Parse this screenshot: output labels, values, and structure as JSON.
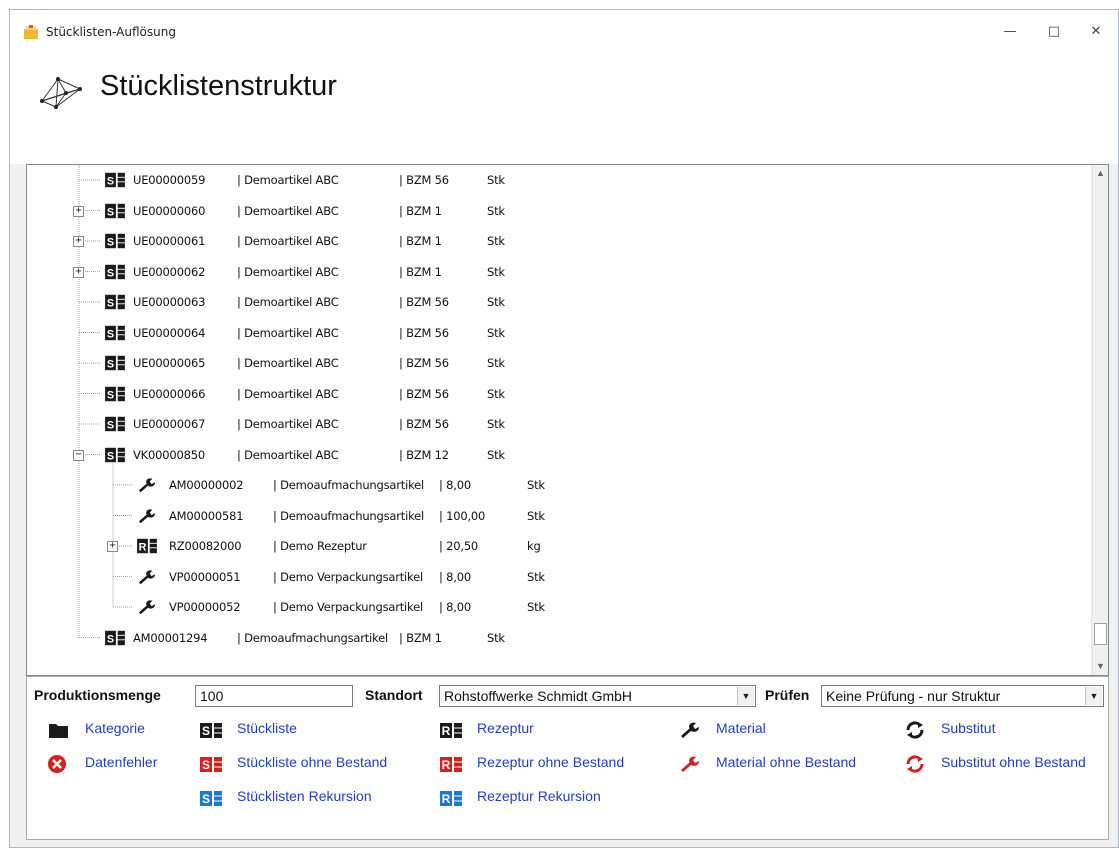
{
  "window": {
    "title": "Stücklisten-Auflösung"
  },
  "header": {
    "title": "Stücklistenstruktur"
  },
  "tree": {
    "rows": [
      {
        "level": 1,
        "type": "S",
        "toggle": "",
        "code": "UE00000059",
        "name": "| Demoartikel ABC",
        "bzm": "| BZM 56",
        "unit": "Stk"
      },
      {
        "level": 1,
        "type": "S",
        "toggle": "+",
        "code": "UE00000060",
        "name": "| Demoartikel ABC",
        "bzm": "| BZM 1",
        "unit": "Stk"
      },
      {
        "level": 1,
        "type": "S",
        "toggle": "+",
        "code": "UE00000061",
        "name": "| Demoartikel ABC",
        "bzm": "| BZM 1",
        "unit": "Stk"
      },
      {
        "level": 1,
        "type": "S",
        "toggle": "+",
        "code": "UE00000062",
        "name": "| Demoartikel ABC",
        "bzm": "| BZM 1",
        "unit": "Stk"
      },
      {
        "level": 1,
        "type": "S",
        "toggle": "",
        "code": "UE00000063",
        "name": "| Demoartikel ABC",
        "bzm": "| BZM 56",
        "unit": "Stk"
      },
      {
        "level": 1,
        "type": "S",
        "toggle": "",
        "code": "UE00000064",
        "name": "| Demoartikel ABC",
        "bzm": "| BZM 56",
        "unit": "Stk"
      },
      {
        "level": 1,
        "type": "S",
        "toggle": "",
        "code": "UE00000065",
        "name": "| Demoartikel ABC",
        "bzm": "| BZM 56",
        "unit": "Stk"
      },
      {
        "level": 1,
        "type": "S",
        "toggle": "",
        "code": "UE00000066",
        "name": "| Demoartikel ABC",
        "bzm": "| BZM 56",
        "unit": "Stk"
      },
      {
        "level": 1,
        "type": "S",
        "toggle": "",
        "code": "UE00000067",
        "name": "| Demoartikel ABC",
        "bzm": "| BZM 56",
        "unit": "Stk"
      },
      {
        "level": 1,
        "type": "S",
        "toggle": "-",
        "code": "VK00000850",
        "name": "| Demoartikel ABC",
        "bzm": "| BZM 12",
        "unit": "Stk"
      },
      {
        "level": 2,
        "type": "M",
        "toggle": "",
        "code": "AM00000002",
        "name": "| Demoaufmachungsartikel",
        "bzm": "| 8,00",
        "unit": "Stk"
      },
      {
        "level": 2,
        "type": "M",
        "toggle": "",
        "code": "AM00000581",
        "name": "| Demoaufmachungsartikel",
        "bzm": "| 100,00",
        "unit": "Stk"
      },
      {
        "level": 2,
        "type": "R",
        "toggle": "+",
        "code": "RZ00082000",
        "name": "| Demo Rezeptur",
        "bzm": "| 20,50",
        "unit": "kg"
      },
      {
        "level": 2,
        "type": "M",
        "toggle": "",
        "code": "VP00000051",
        "name": "| Demo Verpackungsartikel",
        "bzm": "| 8,00",
        "unit": "Stk"
      },
      {
        "level": 2,
        "type": "M",
        "toggle": "",
        "code": "VP00000052",
        "name": "| Demo Verpackungsartikel",
        "bzm": "| 8,00",
        "unit": "Stk"
      },
      {
        "level": 1,
        "type": "S",
        "toggle": "",
        "code": "AM00001294",
        "name": "| Demoaufmachungsartikel",
        "bzm": "| BZM 1",
        "unit": "Stk"
      }
    ]
  },
  "form": {
    "produktionsmenge_label": "Produktionsmenge",
    "produktionsmenge_value": "100",
    "standort_label": "Standort",
    "standort_value": "Rohstoffwerke Schmidt GmbH",
    "pruefen_label": "Prüfen",
    "pruefen_value": "Keine Prüfung - nur Struktur"
  },
  "legend": {
    "kategorie": "Kategorie",
    "stueckliste": "Stückliste",
    "rezeptur": "Rezeptur",
    "material": "Material",
    "substitut": "Substitut",
    "datenfehler": "Datenfehler",
    "stueckliste_ohne": "Stückliste ohne Bestand",
    "rezeptur_ohne": "Rezeptur ohne Bestand",
    "material_ohne": "Material ohne Bestand",
    "substitut_ohne": "Substitut ohne Bestand",
    "stueckliste_rek": "Stücklisten Rekursion",
    "rezeptur_rek": "Rezeptur Rekursion"
  },
  "colors": {
    "link": "#1f3fc0",
    "dark_icon": "#1a1a1a",
    "red_icon": "#d42020",
    "blue_icon": "#1e78d0"
  }
}
